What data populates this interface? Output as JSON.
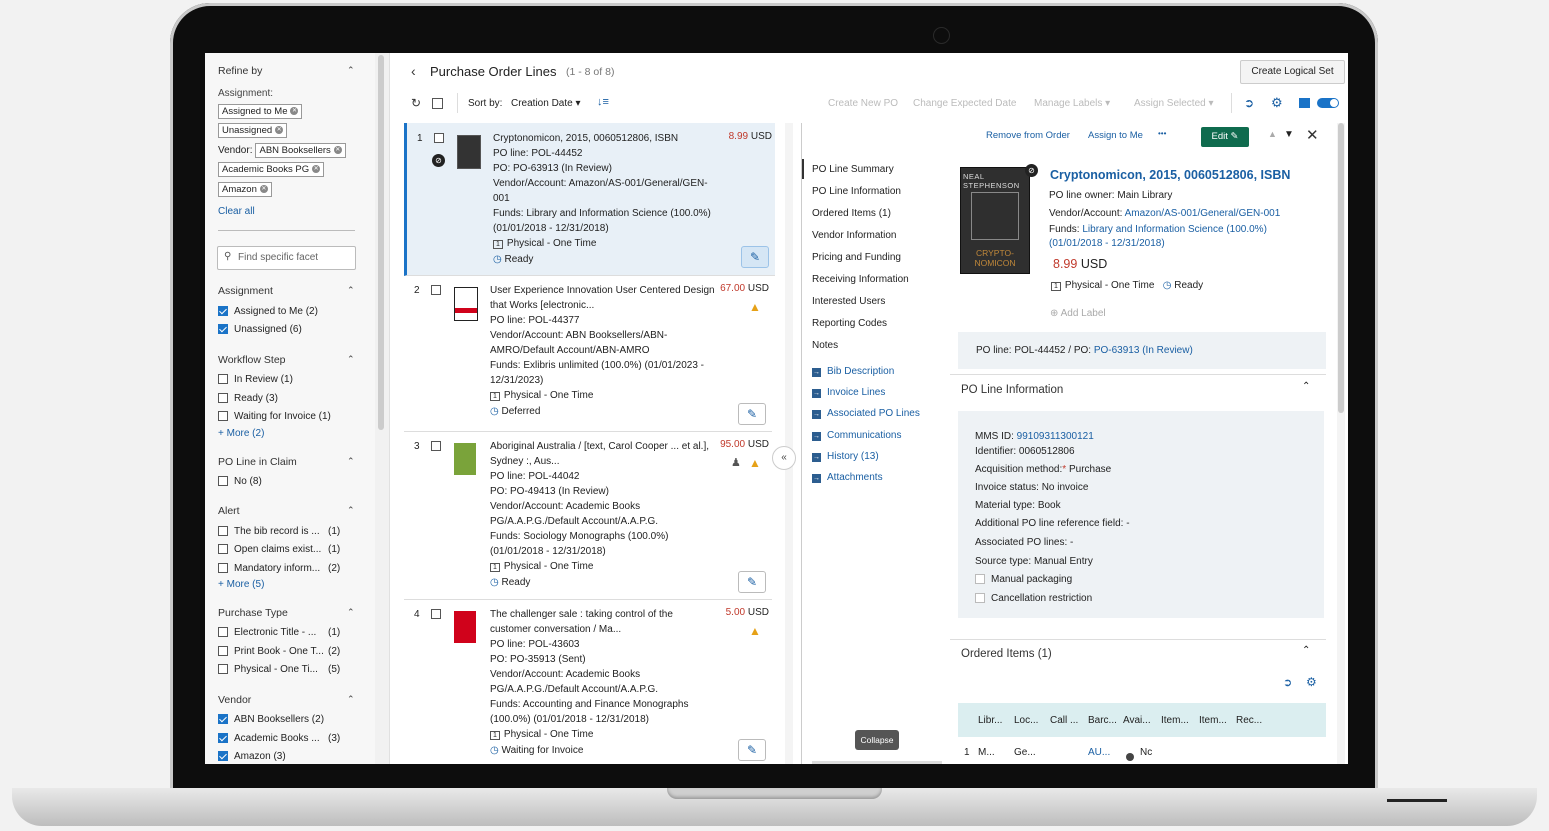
{
  "header": {
    "back_icon": "chevron-left-icon",
    "title": "Purchase Order Lines",
    "count": "(1 - 8 of 8)",
    "create_logical_set": "Create Logical Set",
    "sort_by_label": "Sort by:",
    "sort_by_value": "Creation Date",
    "create_new_po": "Create New PO",
    "change_expected_date": "Change Expected Date",
    "manage_labels": "Manage Labels",
    "assign_selected": "Assign Selected"
  },
  "facets": {
    "refine_by": "Refine by",
    "assignment_label": "Assignment:",
    "chips": [
      "Assigned to Me",
      "Unassigned"
    ],
    "vendor_label": "Vendor:",
    "vendor_chips": [
      "ABN Booksellers",
      "Academic Books PG",
      "Amazon"
    ],
    "clear_all": "Clear all",
    "search_placeholder": "Find specific facet",
    "groups": {
      "assignment": {
        "title": "Assignment",
        "items": [
          {
            "label": "Assigned to Me (2)",
            "checked": true
          },
          {
            "label": "Unassigned (6)",
            "checked": true
          }
        ]
      },
      "workflow": {
        "title": "Workflow Step",
        "items": [
          {
            "label": "In Review (1)"
          },
          {
            "label": "Ready (3)"
          },
          {
            "label": "Waiting for Invoice (1)"
          }
        ],
        "more": "+ More (2)"
      },
      "claim": {
        "title": "PO Line in Claim",
        "items": [
          {
            "label": "No (8)"
          }
        ]
      },
      "alert": {
        "title": "Alert",
        "items": [
          {
            "label": "The bib record is ...",
            "count": "(1)"
          },
          {
            "label": "Open claims exist...",
            "count": "(1)"
          },
          {
            "label": "Mandatory inform...",
            "count": "(2)"
          }
        ],
        "more": "+ More (5)"
      },
      "purchase_type": {
        "title": "Purchase Type",
        "items": [
          {
            "label": "Electronic Title - ...",
            "count": "(1)"
          },
          {
            "label": "Print Book - One T...",
            "count": "(2)"
          },
          {
            "label": "Physical - One Ti...",
            "count": "(5)"
          }
        ]
      },
      "vendor": {
        "title": "Vendor",
        "items": [
          {
            "label": "ABN Booksellers (2)",
            "checked": true
          },
          {
            "label": "Academic Books ...",
            "count": "(3)",
            "checked": true
          },
          {
            "label": "Amazon (3)",
            "checked": true
          }
        ]
      }
    }
  },
  "items": [
    {
      "num": "1",
      "title": "Cryptonomicon, 2015, 0060512806, ISBN",
      "price": "8.99",
      "currency": "USD",
      "po_line": "PO line: POL-44452",
      "po": "PO: PO-63913 (In Review)",
      "vendor": "Vendor/Account: Amazon/AS-001/General/GEN-001",
      "funds": "Funds: Library and Information Science (100.0%) (01/01/2018 - 12/31/2018)",
      "type": "Physical - One Time",
      "status": "Ready"
    },
    {
      "num": "2",
      "title": "User Experience Innovation User Centered Design that Works [electronic...",
      "price": "67.00",
      "currency": "USD",
      "po_line": "PO line: POL-44377",
      "vendor": "Vendor/Account: ABN Booksellers/ABN-AMRO/Default Account/ABN-AMRO",
      "funds": "Funds: Exlibris unlimited (100.0%) (01/01/2023 - 12/31/2023)",
      "type": "Physical - One Time",
      "status": "Deferred"
    },
    {
      "num": "3",
      "title": "Aboriginal Australia / [text, Carol Cooper ... et al.], Sydney :, Aus...",
      "price": "95.00",
      "currency": "USD",
      "po_line": "PO line: POL-44042",
      "po": "PO: PO-49413 (In Review)",
      "vendor": "Vendor/Account: Academic Books PG/A.A.P.G./Default Account/A.A.P.G.",
      "funds": "Funds: Sociology Monographs (100.0%) (01/01/2018 - 12/31/2018)",
      "type": "Physical - One Time",
      "status": "Ready"
    },
    {
      "num": "4",
      "title": "The challenger sale : taking control of the customer conversation / Ma...",
      "price": "5.00",
      "currency": "USD",
      "po_line": "PO line: POL-43603",
      "po": "PO: PO-35913 (Sent)",
      "vendor": "Vendor/Account: Academic Books PG/A.A.P.G./Default Account/A.A.P.G.",
      "funds": "Funds: Accounting and Finance Monographs (100.0%) (01/01/2018 - 12/31/2018)",
      "type": "Physical - One Time",
      "status": "Waiting for Invoice"
    }
  ],
  "detail_nav": {
    "items": [
      "PO Line Summary",
      "PO Line Information",
      "Ordered Items (1)",
      "Vendor Information",
      "Pricing and Funding",
      "Receiving Information",
      "Interested Users",
      "Reporting Codes",
      "Notes"
    ],
    "links": [
      "Bib Description",
      "Invoice Lines",
      "Associated PO Lines",
      "Communications",
      "History (13)",
      "Attachments"
    ],
    "collapse_tooltip": "Collapse"
  },
  "detail": {
    "remove_from_order": "Remove from Order",
    "assign_to_me": "Assign to Me",
    "more": "•••",
    "edit": "Edit",
    "title": "Cryptonomicon, 2015, 0060512806, ISBN",
    "cover_author": "NEAL STEPHENSON",
    "cover_title": "CRYPTO-NOMICON",
    "owner": "PO line owner: Main Library",
    "vendor_label": "Vendor/Account:",
    "vendor_value": "Amazon/AS-001/General/GEN-001",
    "funds_label": "Funds:",
    "funds_value": "Library and Information Science (100.0%) (01/01/2018 - 12/31/2018)",
    "price": "8.99",
    "currency": "USD",
    "type": "Physical - One Time",
    "status": "Ready",
    "add_label": "Add Label",
    "po_summary_prefix": "PO line: POL-44452 / PO:",
    "po_summary_link": "PO-63913 (In Review)",
    "po_info_title": "PO Line Information",
    "mms_label": "MMS ID:",
    "mms_value": "99109311300121",
    "identifier_label": "Identifier:",
    "identifier_value": "0060512806",
    "acq_label": "Acquisition method:",
    "acq_value": "Purchase",
    "invoice_label": "Invoice status:",
    "invoice_value": "No invoice",
    "material_label": "Material type:",
    "material_value": "Book",
    "addl_ref": "Additional PO line reference field: -",
    "assoc": "Associated PO lines: -",
    "source_label": "Source type:",
    "source_value": "Manual Entry",
    "manual_packaging": "Manual packaging",
    "cancellation": "Cancellation restriction",
    "ordered_title": "Ordered Items (1)",
    "table_headers": [
      "Libr...",
      "Loc...",
      "Call ...",
      "Barc...",
      "Avai...",
      "Item...",
      "Item...",
      "Rec..."
    ],
    "table_row": [
      "1",
      "M...",
      "Ge...",
      "",
      "AU...",
      "Nc"
    ]
  },
  "colors": {
    "accent": "#1a73c7",
    "price": "#c0392b",
    "edit_green": "#0f6b4e",
    "warning": "#e6a117"
  }
}
